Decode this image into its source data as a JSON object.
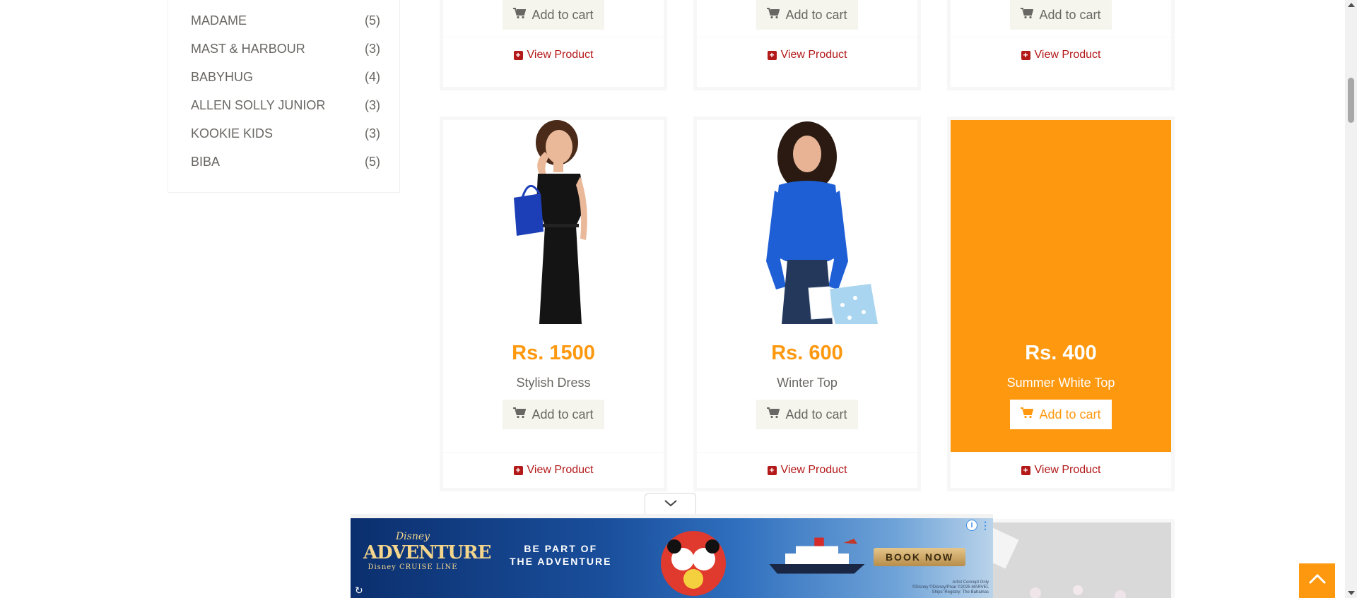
{
  "brands": [
    {
      "name": "MADAME",
      "count": "(5)"
    },
    {
      "name": "MAST & HARBOUR",
      "count": "(3)"
    },
    {
      "name": "BABYHUG",
      "count": "(4)"
    },
    {
      "name": "ALLEN SOLLY JUNIOR",
      "count": "(3)"
    },
    {
      "name": "KOOKIE KIDS",
      "count": "(3)"
    },
    {
      "name": "BIBA",
      "count": "(5)"
    }
  ],
  "actions": {
    "add_to_cart": "Add to cart",
    "view_product": "View Product"
  },
  "products": [
    {
      "price": "Rs. 1500",
      "name": "Stylish Dress"
    },
    {
      "price": "Rs. 600",
      "name": "Winter Top"
    },
    {
      "price": "Rs. 400",
      "name": "Summer White Top"
    }
  ],
  "ad": {
    "logo_small": "Disney",
    "logo_big": "ADVENTURE",
    "logo_line": "Disney CRUISE LINE",
    "tagline_1": "BE PART OF",
    "tagline_2": "THE ADVENTURE",
    "cta": "BOOK NOW",
    "fine_1": "Artist Concept Only",
    "fine_2": "©Disney ©Disney/Pixar ©2025 MARVEL",
    "fine_3": "Ships' Registry: The Bahamas"
  },
  "colors": {
    "accent": "#fe980f",
    "link": "#b4191a",
    "text": "#696763",
    "button_bg": "#f5f5ed"
  }
}
